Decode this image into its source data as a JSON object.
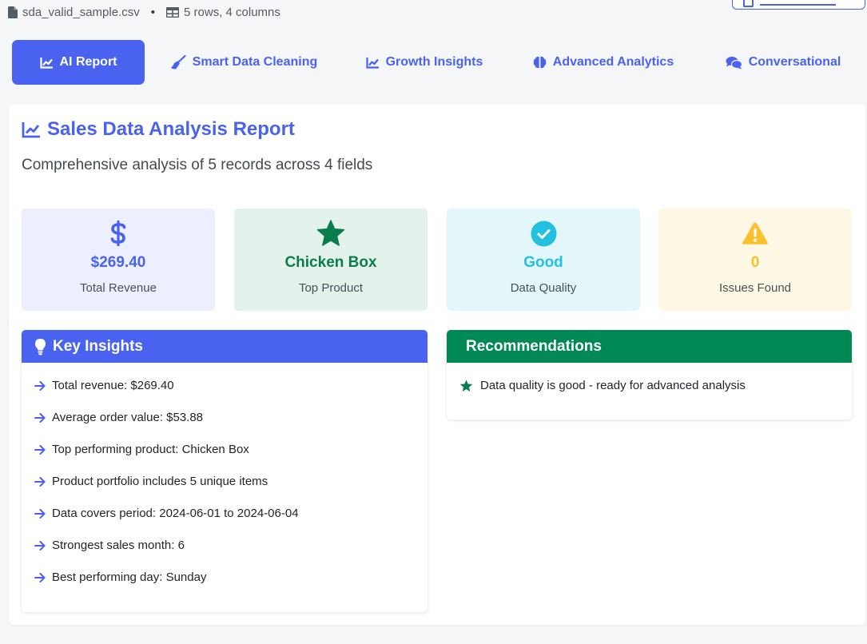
{
  "file": {
    "name": "sda_valid_sample.csv",
    "separator": "•",
    "shape": "5 rows, 4 columns"
  },
  "tabs": [
    {
      "label": "AI Report",
      "icon": "chart-line-icon",
      "active": true
    },
    {
      "label": "Smart Data Cleaning",
      "icon": "broom-icon",
      "active": false
    },
    {
      "label": "Growth Insights",
      "icon": "chart-line-icon",
      "active": false
    },
    {
      "label": "Advanced Analytics",
      "icon": "brain-icon",
      "active": false
    },
    {
      "label": "Conversational",
      "icon": "comments-icon",
      "active": false
    }
  ],
  "report": {
    "title": "Sales Data Analysis Report",
    "subtitle": "Comprehensive analysis of 5 records across 4 fields"
  },
  "cards": [
    {
      "value": "$269.40",
      "label": "Total Revenue",
      "icon": "dollar-icon",
      "color": "#4a62f0",
      "bg": "#eceffe"
    },
    {
      "value": "Chicken Box",
      "label": "Top Product",
      "icon": "star-icon",
      "color": "#0a7d4f",
      "bg": "#e4f2ec"
    },
    {
      "value": "Good",
      "label": "Data Quality",
      "icon": "check-circle-icon",
      "color": "#22c1e0",
      "bg": "#e3f7fb"
    },
    {
      "value": "0",
      "label": "Issues Found",
      "icon": "warning-icon",
      "color": "#fbc02d",
      "bg": "#fff8e5"
    }
  ],
  "insights": {
    "title": "Key Insights",
    "items": [
      "Total revenue: $269.40",
      "Average order value: $53.88",
      "Top performing product: Chicken Box",
      "Product portfolio includes 5 unique items",
      "Data covers period: 2024-06-01 to 2024-06-04",
      "Strongest sales month: 6",
      "Best performing day: Sunday"
    ]
  },
  "recommendations": {
    "title": "Recommendations",
    "items": [
      "Data quality is good - ready for advanced analysis"
    ]
  },
  "colors": {
    "accent": "#4a62f0",
    "success": "#008856"
  }
}
